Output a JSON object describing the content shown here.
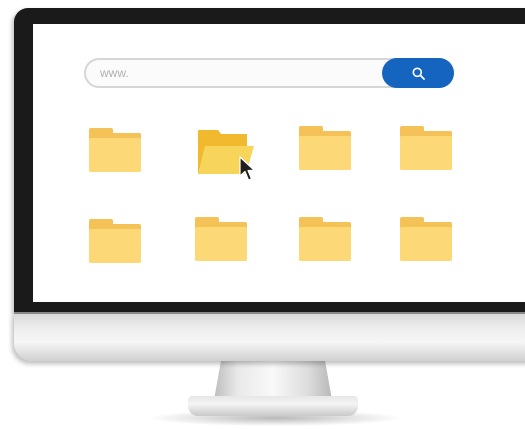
{
  "search": {
    "placeholder": "www.",
    "button_icon": "search-icon"
  },
  "colors": {
    "bezel": "#1a1a1a",
    "accent_button": "#1565c0",
    "folder_back": "#f5c258",
    "folder_front": "#fcd976",
    "folder_open_back": "#f0b92e",
    "folder_open_front": "#f7d45a"
  },
  "folders": [
    {
      "state": "closed"
    },
    {
      "state": "open-hovered"
    },
    {
      "state": "closed"
    },
    {
      "state": "closed"
    },
    {
      "state": "closed"
    },
    {
      "state": "closed"
    },
    {
      "state": "closed"
    },
    {
      "state": "closed"
    }
  ],
  "cursor": {
    "icon": "pointer-cursor-icon"
  }
}
